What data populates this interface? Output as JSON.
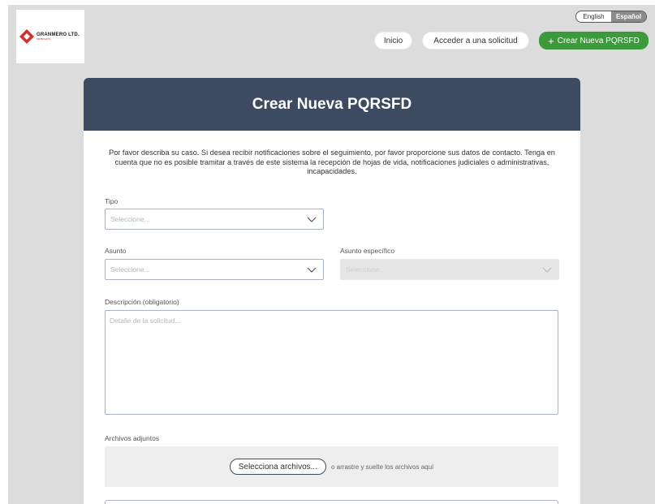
{
  "brand": {
    "name": "GRANMERO LTD.",
    "subtitle": "DE BOGOTA"
  },
  "language": {
    "english": "English",
    "spanish": "Español"
  },
  "nav": {
    "inicio": "Inicio",
    "acceder": "Acceder a una solicitud",
    "crear": "Crear Nueva PQRSFD"
  },
  "form": {
    "title": "Crear Nueva PQRSFD",
    "intro": "Por favor describa su caso. Si desea recibir notificaciones sobre el seguimiento, por favor proporcione sus datos de contacto. Tenga en cuenta que no es posible tramitar a través de este sistema la recepción de hojas de vida, notificaciones judiciales o administrativas, incapacidades.",
    "tipo": {
      "label": "Tipo",
      "placeholder": "Seleccione..."
    },
    "asunto": {
      "label": "Asunto",
      "placeholder": "Seleccione..."
    },
    "asunto_especifico": {
      "label": "Asunto específico",
      "placeholder": "Seleccione..."
    },
    "descripcion": {
      "label": "Descripción (obligatorio)",
      "placeholder": "Detalle de la solicitud..."
    },
    "adjuntos": {
      "label": "Archivos adjuntos",
      "button": "Selecciona archivos...",
      "hint": "o arrastre y suelte los archivos aquí"
    }
  },
  "colors": {
    "header_bg": "#3d4b61",
    "accent_green": "#3c9a3c",
    "page_bg": "#dcdcdc"
  }
}
